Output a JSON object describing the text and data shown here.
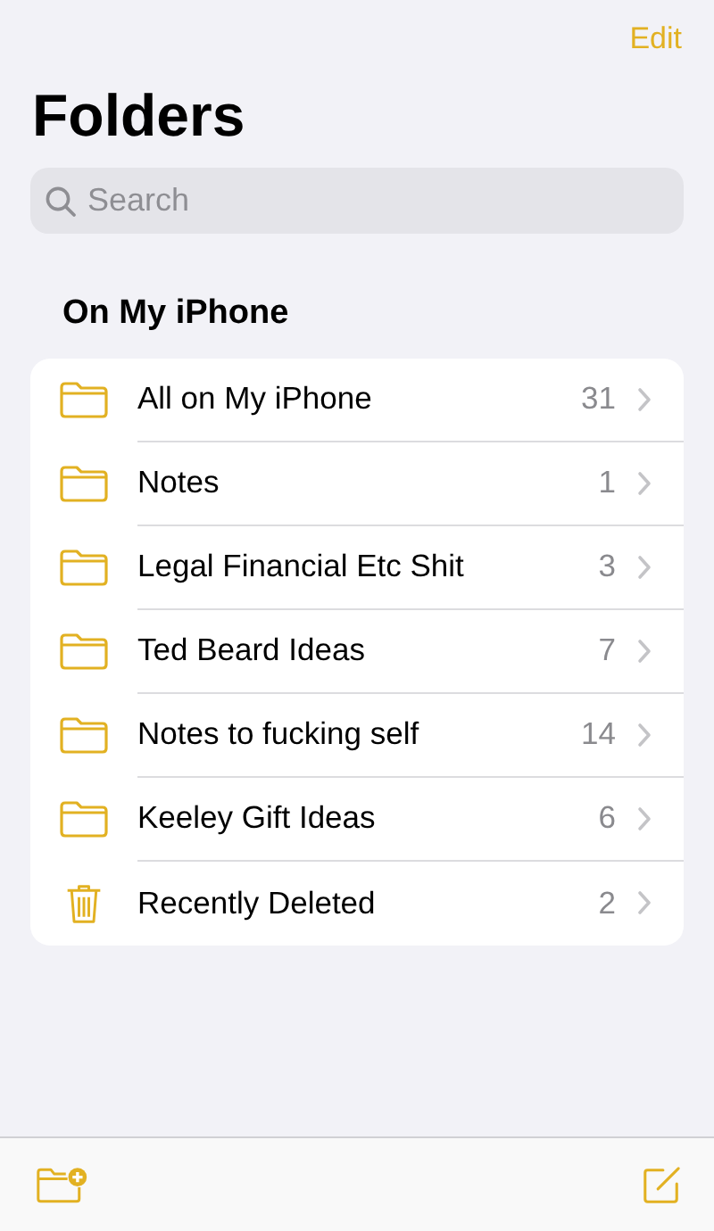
{
  "nav": {
    "edit": "Edit"
  },
  "title": "Folders",
  "search": {
    "placeholder": "Search"
  },
  "section": {
    "title": "On My iPhone"
  },
  "folders": [
    {
      "kind": "folder",
      "name": "All on My iPhone",
      "count": "31"
    },
    {
      "kind": "folder",
      "name": "Notes",
      "count": "1"
    },
    {
      "kind": "folder",
      "name": "Legal Financial Etc Shit",
      "count": "3"
    },
    {
      "kind": "folder",
      "name": "Ted Beard Ideas",
      "count": "7"
    },
    {
      "kind": "folder",
      "name": "Notes to fucking self",
      "count": "14"
    },
    {
      "kind": "folder",
      "name": "Keeley Gift Ideas",
      "count": "6"
    },
    {
      "kind": "trash",
      "name": "Recently Deleted",
      "count": "2"
    }
  ]
}
